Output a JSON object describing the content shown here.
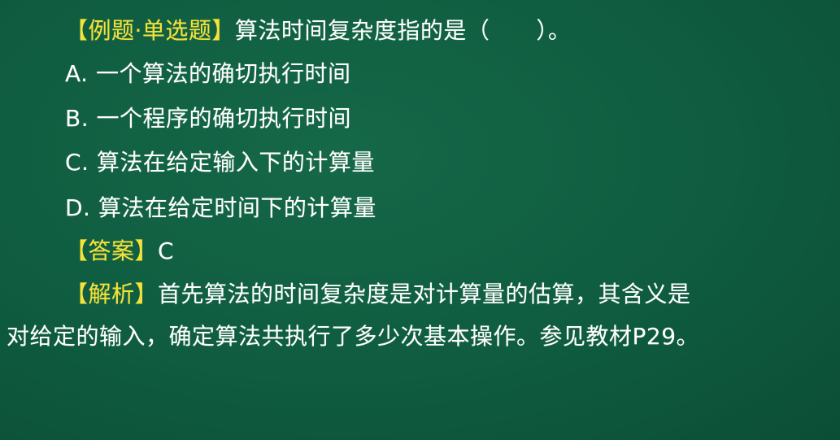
{
  "question": {
    "tag": "【例题·单选题】",
    "text": "算法时间复杂度指的是（　　）。"
  },
  "options": [
    {
      "text": "A. 一个算法的确切执行时间"
    },
    {
      "text": "B. 一个程序的确切执行时间"
    },
    {
      "text": "C. 算法在给定输入下的计算量"
    },
    {
      "text": "D. 算法在给定时间下的计算量"
    }
  ],
  "answer": {
    "tag": "【答案】",
    "value": "C"
  },
  "explanation": {
    "tag": "【解析】",
    "line1": "首先算法的时间复杂度是对计算量的估算，其含义是",
    "line2": "对给定的输入，确定算法共执行了多少次基本操作。参见教材P29。"
  },
  "colors": {
    "background": "#0f5c40",
    "tag": "#f5e23a",
    "text": "#ffffff"
  }
}
